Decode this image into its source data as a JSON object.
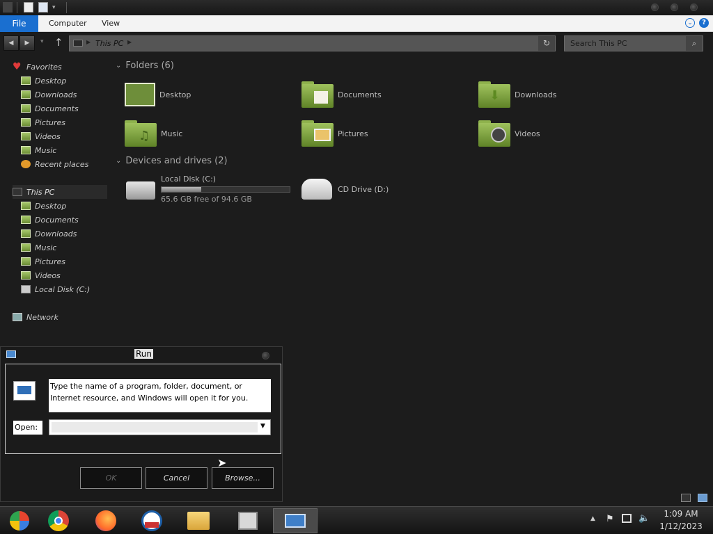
{
  "ribbon": {
    "tabs": [
      "File",
      "Computer",
      "View"
    ]
  },
  "address": {
    "location": "This PC",
    "search_placeholder": "Search This PC"
  },
  "sidebar": {
    "favorites_label": "Favorites",
    "favorites": [
      "Desktop",
      "Downloads",
      "Documents",
      "Pictures",
      "Videos",
      "Music",
      "Recent places"
    ],
    "thispc_label": "This PC",
    "thispc_items": [
      "Desktop",
      "Documents",
      "Downloads",
      "Music",
      "Pictures",
      "Videos",
      "Local Disk (C:)"
    ],
    "network_label": "Network"
  },
  "main": {
    "folders_header": "Folders (6)",
    "folders": [
      "Desktop",
      "Documents",
      "Downloads",
      "Music",
      "Pictures",
      "Videos"
    ],
    "drives_header": "Devices and drives (2)",
    "drive_c": {
      "name": "Local Disk (C:)",
      "free": "65.6 GB free of 94.6 GB",
      "used_fraction": 0.31
    },
    "drive_d": {
      "name": "CD Drive (D:)"
    }
  },
  "run_dialog": {
    "title": "Run",
    "description": "Type the name of a program, folder, document, or Internet resource, and Windows will open it for you.",
    "open_label": "Open:",
    "open_value": "",
    "ok": "OK",
    "cancel": "Cancel",
    "browse": "Browse..."
  },
  "clock": {
    "time": "1:09 AM",
    "date": "1/12/2023"
  },
  "colors": {
    "accent": "#1a6fd0",
    "folder_green": "#8fb34d",
    "background": "#1c1c1c"
  }
}
